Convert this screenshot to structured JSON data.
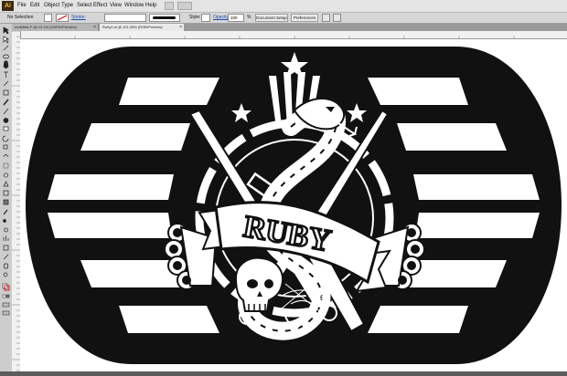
{
  "app": {
    "logo_text": "Ai"
  },
  "menubar": {
    "items": [
      "File",
      "Edit",
      "Object",
      "Type",
      "Select",
      "Effect",
      "View",
      "Window",
      "Help"
    ]
  },
  "control_bar": {
    "selection_label": "No Selection",
    "stroke_label": "Stroke:",
    "style_label": "Style:",
    "opacity_label": "Opacity:",
    "opacity_value": "100",
    "opacity_unit": "%",
    "document_setup_label": "Document Setup",
    "preferences_label": "Preferences"
  },
  "tabs": [
    {
      "label": "undefine-F-@-12.1% (CMYK/Preview)",
      "active": false
    },
    {
      "label": "Ruby2.ai @ 121.28% (RGB/Preview)",
      "active": true
    }
  ],
  "artwork": {
    "banner_text": "RUBY"
  },
  "colors": {
    "ink": "#111111",
    "paper": "#ffffff",
    "chrome": "#d6d6d6",
    "app_accent": "#ffb13b"
  },
  "icons": {
    "tools": [
      "selection",
      "direct-selection",
      "magic-wand",
      "lasso",
      "pen",
      "type",
      "line",
      "rectangle",
      "paintbrush",
      "pencil",
      "blob-brush",
      "eraser",
      "rotate",
      "scale",
      "warp",
      "free-transform",
      "shape-builder",
      "perspective-grid",
      "mesh",
      "gradient",
      "eyedropper",
      "blend",
      "symbol-sprayer",
      "column-graph",
      "artboard",
      "slice",
      "hand",
      "zoom"
    ]
  }
}
